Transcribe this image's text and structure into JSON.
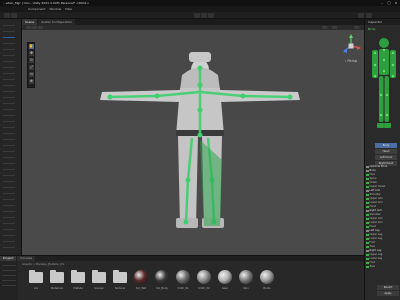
{
  "window": {
    "title": "...ation_Mgr | Unu - Unity 2021.3.XXf1 Personal* <DX11>"
  },
  "menu": [
    "Component",
    "Window",
    "Help"
  ],
  "scene": {
    "tabs": [
      "Scene",
      "Avatar Configuration"
    ],
    "active_tab": "Scene"
  },
  "tools": [
    "hand-tool",
    "move-tool",
    "rotate-tool",
    "scale-tool",
    "rect-tool",
    "transform-tool"
  ],
  "gizmo": {
    "persp_label": "‹ Persp"
  },
  "inspector": {
    "header": "Inspector",
    "avatar_label": "Body",
    "mapping_buttons": [
      "Body",
      "Head",
      "Left Hand",
      "Right Hand"
    ],
    "bones": [
      {
        "label": "Optional Bone",
        "group": true
      },
      {
        "label": "Body",
        "group": true
      },
      {
        "label": "Hips",
        "group": false
      },
      {
        "label": "Spine",
        "group": false
      },
      {
        "label": "Chest",
        "group": false
      },
      {
        "label": "Upper Chest",
        "group": false
      },
      {
        "label": "Left Arm",
        "group": true
      },
      {
        "label": "Shoulder",
        "group": false
      },
      {
        "label": "Upper Arm",
        "group": false
      },
      {
        "label": "Lower Arm",
        "group": false
      },
      {
        "label": "Hand",
        "group": false
      },
      {
        "label": "Right Arm",
        "group": true
      },
      {
        "label": "Shoulder",
        "group": false
      },
      {
        "label": "Upper Arm",
        "group": false
      },
      {
        "label": "Lower Arm",
        "group": false
      },
      {
        "label": "Hand",
        "group": false
      },
      {
        "label": "Left Leg",
        "group": true
      },
      {
        "label": "Upper Leg",
        "group": false
      },
      {
        "label": "Lower Leg",
        "group": false
      },
      {
        "label": "Foot",
        "group": false
      },
      {
        "label": "Toes",
        "group": false
      },
      {
        "label": "Right Leg",
        "group": true
      },
      {
        "label": "Upper Leg",
        "group": false
      },
      {
        "label": "Lower Leg",
        "group": false
      },
      {
        "label": "Foot",
        "group": false
      },
      {
        "label": "Toes",
        "group": false
      }
    ],
    "bottom_buttons": [
      "Revert",
      "Apply"
    ]
  },
  "project": {
    "tabs": [
      "Project",
      "Console"
    ],
    "breadcrumb": "Assets > Escape_Bubble_01",
    "assets": [
      {
        "label": "Ani",
        "kind": "folder",
        "color": "#c9c9c9"
      },
      {
        "label": "Materials",
        "kind": "folder",
        "color": "#c9c9c9"
      },
      {
        "label": "Prefabs",
        "kind": "folder",
        "color": "#c9c9c9"
      },
      {
        "label": "Scenes",
        "kind": "folder",
        "color": "#c9c9c9"
      },
      {
        "label": "Textures",
        "kind": "folder",
        "color": "#c9c9c9"
      },
      {
        "label": "Sol_Mat",
        "kind": "sphere",
        "color": "#5a2a2a"
      },
      {
        "label": "Sol_Body",
        "kind": "sphere",
        "color": "#3a3a3a"
      },
      {
        "label": "Cloth_01",
        "kind": "sphere",
        "color": "#6b6b6b"
      },
      {
        "label": "Cloth_02",
        "kind": "sphere",
        "color": "#8a8a8a"
      },
      {
        "label": "Gear",
        "kind": "sphere",
        "color": "#b0b0b0"
      },
      {
        "label": "Skin",
        "kind": "sphere",
        "color": "#7a7a7a"
      },
      {
        "label": "Boots",
        "kind": "sphere",
        "color": "#9a9a9a"
      }
    ]
  },
  "colors": {
    "accent": "#4a6ea3",
    "bone_green": "#3fcf6f",
    "scene_bg": "#444444"
  }
}
